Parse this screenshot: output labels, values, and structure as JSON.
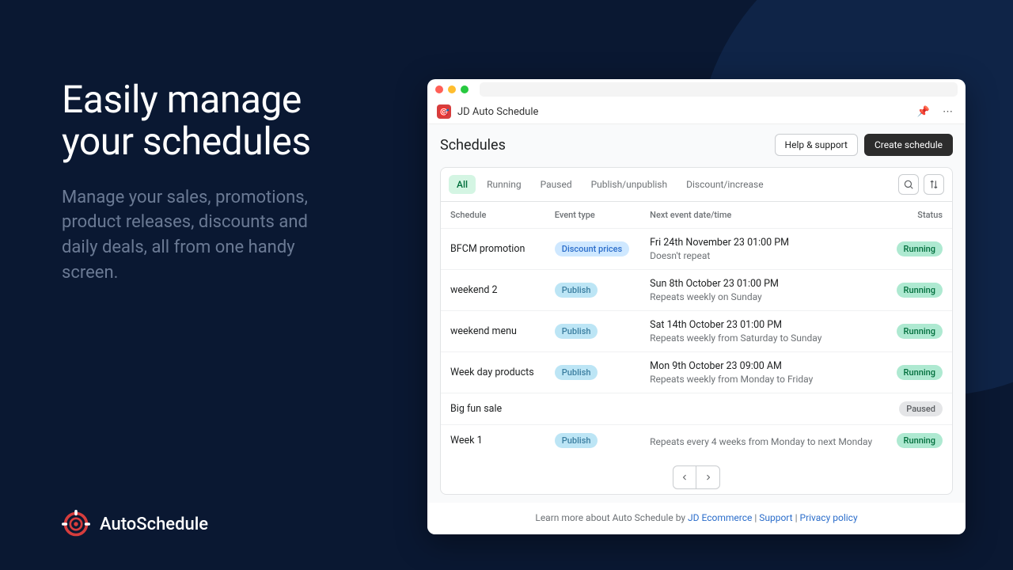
{
  "promo": {
    "heading": "Easily manage your schedules",
    "subtext": "Manage your sales, promotions, product releases, discounts and daily deals, all from one handy screen.",
    "brand": "AutoSchedule"
  },
  "app": {
    "title": "JD Auto Schedule",
    "page_title": "Schedules",
    "help_label": "Help & support",
    "create_label": "Create schedule",
    "tabs": {
      "all": "All",
      "running": "Running",
      "paused": "Paused",
      "pubunpub": "Publish/unpublish",
      "discinc": "Discount/increase"
    },
    "columns": {
      "schedule": "Schedule",
      "event_type": "Event type",
      "next": "Next event date/time",
      "status": "Status"
    },
    "rows": [
      {
        "name": "BFCM promotion",
        "event": "Discount prices",
        "event_style": "discount",
        "next1": "Fri 24th November 23 01:00 PM",
        "next2": "Doesn't repeat",
        "status": "Running",
        "status_style": "running"
      },
      {
        "name": "weekend 2",
        "event": "Publish",
        "event_style": "publish",
        "next1": "Sun 8th October 23 01:00 PM",
        "next2": "Repeats weekly on Sunday",
        "status": "Running",
        "status_style": "running"
      },
      {
        "name": "weekend menu",
        "event": "Publish",
        "event_style": "publish",
        "next1": "Sat 14th October 23 01:00 PM",
        "next2": "Repeats weekly from Saturday to Sunday",
        "status": "Running",
        "status_style": "running"
      },
      {
        "name": "Week day products",
        "event": "Publish",
        "event_style": "publish",
        "next1": "Mon 9th October 23 09:00 AM",
        "next2": "Repeats weekly from Monday to Friday",
        "status": "Running",
        "status_style": "running"
      },
      {
        "name": "Big fun sale",
        "event": "",
        "event_style": "",
        "next1": "",
        "next2": "",
        "status": "Paused",
        "status_style": "paused"
      },
      {
        "name": "Week 1",
        "event": "Publish",
        "event_style": "publish",
        "next1": "",
        "next2": "Repeats every 4 weeks from Monday to next Monday",
        "status": "Running",
        "status_style": "running"
      }
    ],
    "footer": {
      "learn": "Learn more about Auto Schedule by ",
      "jd": "JD Ecommerce",
      "support": "Support",
      "privacy": "Privacy policy",
      "sep": " | "
    }
  }
}
